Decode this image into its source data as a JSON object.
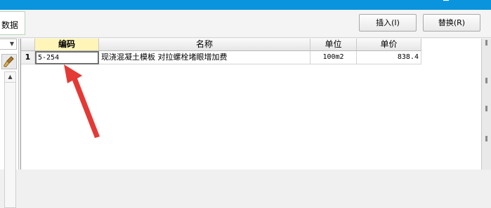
{
  "titlebar": {
    "ghost_text": "",
    "minimize_glyph": "─"
  },
  "toolbar": {
    "data_tab": "数据",
    "insert_label": "插入(I)",
    "replace_label": "替换(R)"
  },
  "left_panel": {
    "dropdown_glyph": "▼",
    "brush_icon": "brush-icon",
    "scroll_up_glyph": "▲"
  },
  "table": {
    "columns": [
      "编码",
      "名称",
      "单位",
      "单价"
    ],
    "rows": [
      {
        "num": "1",
        "code": "5-254",
        "name": "现浇混凝土模板 对拉螺栓堵眼增加费",
        "unit": "100m2",
        "price": "838.4"
      }
    ]
  },
  "annotation": {
    "color": "#e53935"
  }
}
